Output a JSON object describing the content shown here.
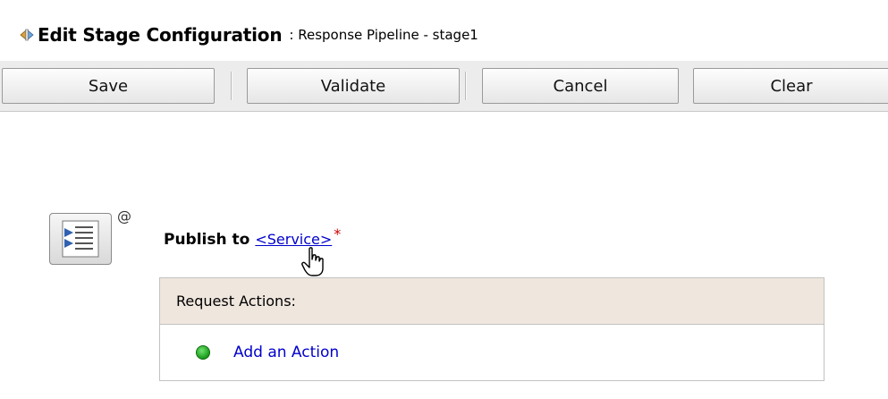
{
  "header": {
    "title": "Edit Stage Configuration",
    "subtitle": ": Response Pipeline - stage1",
    "icon": "stage-config-icon"
  },
  "toolbar": {
    "buttons": [
      {
        "label": "Save"
      },
      {
        "label": "Validate"
      },
      {
        "label": "Cancel"
      },
      {
        "label": "Clear"
      }
    ]
  },
  "stage": {
    "icon": "publish-action-icon",
    "badge": "@",
    "publish_label": "Publish to",
    "service_link": "<Service>",
    "required_marker": "*"
  },
  "request_actions": {
    "header": "Request Actions:",
    "add_action": "Add an Action",
    "status_color": "#1a9a1a"
  },
  "colors": {
    "link": "#0000cc",
    "required": "#cc0000",
    "section_header_bg": "#efe6de"
  }
}
